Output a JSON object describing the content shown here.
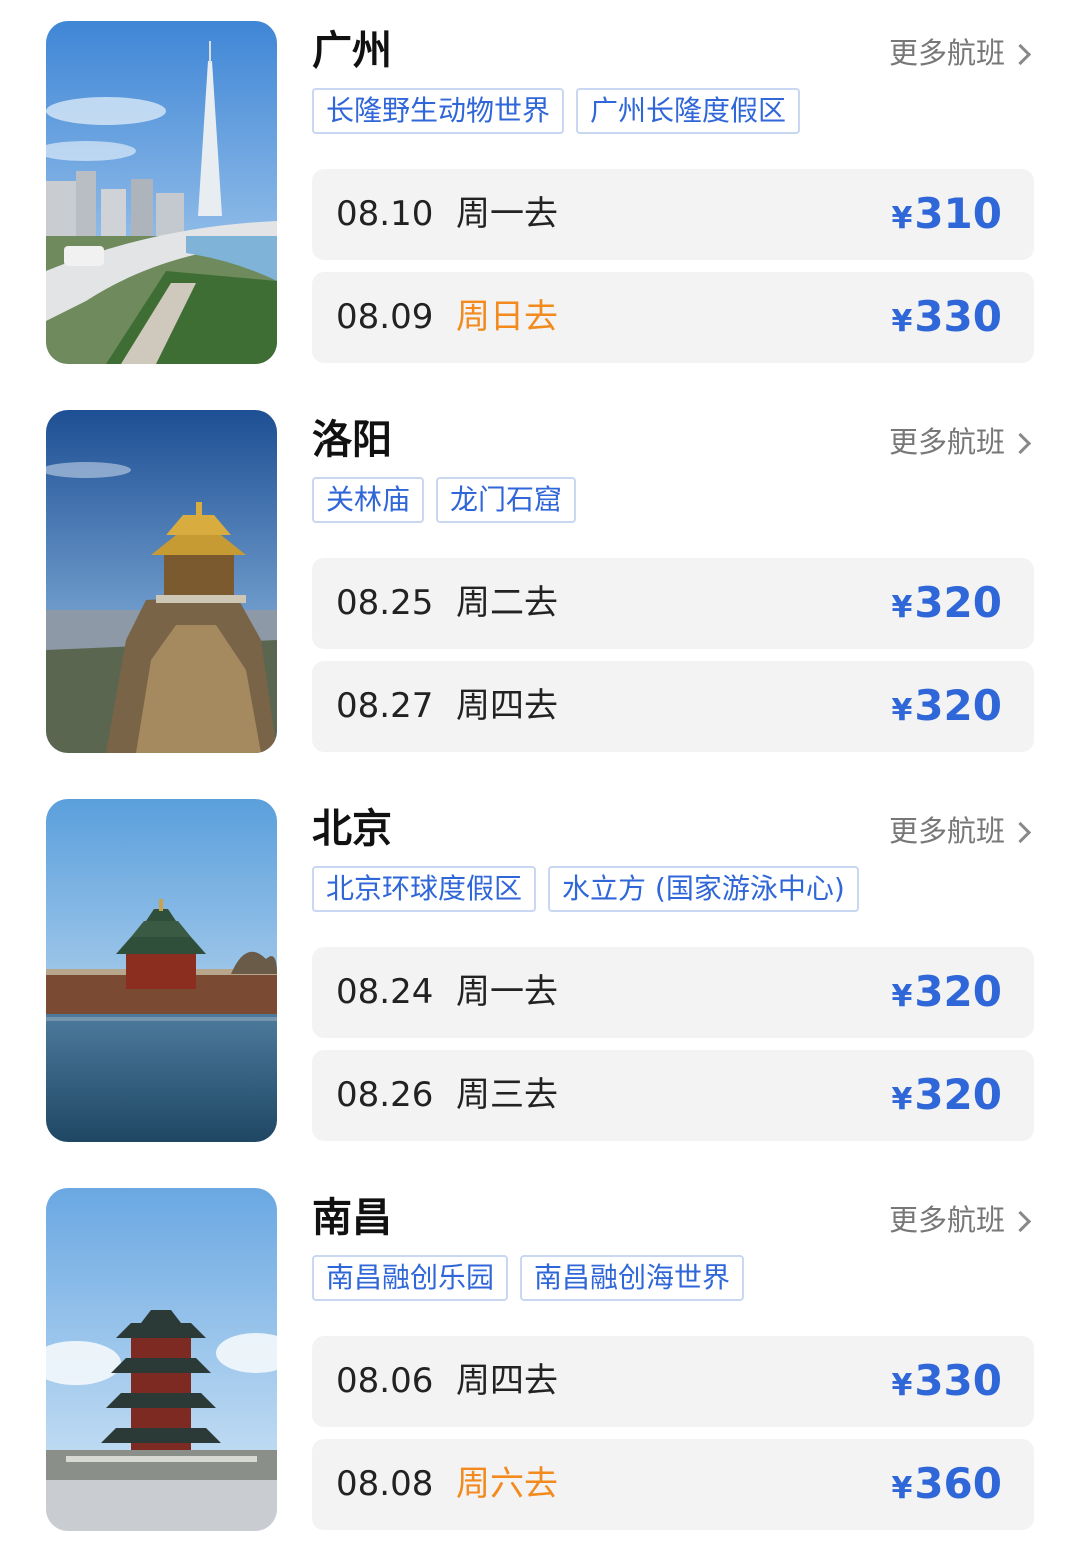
{
  "more_label": "更多航班",
  "currency": "¥",
  "colors": {
    "accent": "#2f66d8",
    "weekend": "#f28a1e"
  },
  "cards": [
    {
      "city": "广州",
      "image": "canton-tower-photo",
      "tags": [
        "长隆野生动物世界",
        "广州长隆度假区"
      ],
      "flights": [
        {
          "date": "08.10",
          "day": "周一去",
          "price": "310",
          "weekend": false
        },
        {
          "date": "08.09",
          "day": "周日去",
          "price": "330",
          "weekend": true
        }
      ]
    },
    {
      "city": "洛阳",
      "image": "mountain-pavilion-photo",
      "tags": [
        "关林庙",
        "龙门石窟"
      ],
      "flights": [
        {
          "date": "08.25",
          "day": "周二去",
          "price": "320",
          "weekend": false
        },
        {
          "date": "08.27",
          "day": "周四去",
          "price": "320",
          "weekend": false
        }
      ]
    },
    {
      "city": "北京",
      "image": "forbidden-city-corner-tower-photo",
      "tags": [
        "北京环球度假区",
        "水立方 (国家游泳中心)"
      ],
      "flights": [
        {
          "date": "08.24",
          "day": "周一去",
          "price": "320",
          "weekend": false
        },
        {
          "date": "08.26",
          "day": "周三去",
          "price": "320",
          "weekend": false
        }
      ]
    },
    {
      "city": "南昌",
      "image": "tengwang-pavilion-photo",
      "tags": [
        "南昌融创乐园",
        "南昌融创海世界"
      ],
      "flights": [
        {
          "date": "08.06",
          "day": "周四去",
          "price": "330",
          "weekend": false
        },
        {
          "date": "08.08",
          "day": "周六去",
          "price": "360",
          "weekend": true
        }
      ]
    }
  ]
}
